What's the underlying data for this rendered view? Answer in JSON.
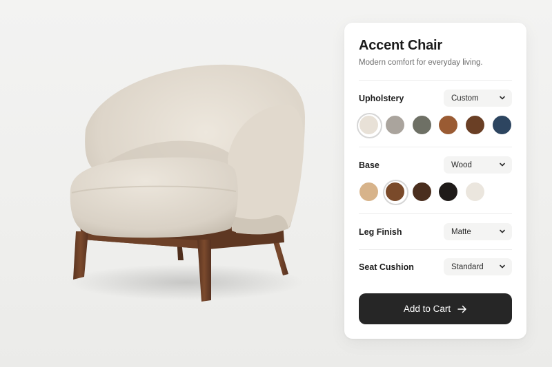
{
  "product": {
    "title": "Accent Chair",
    "subtitle": "Modern comfort for everyday living."
  },
  "upholstery": {
    "label": "Upholstery",
    "selected": "Custom",
    "swatches": [
      {
        "color": "#e8e1d7",
        "selected": true
      },
      {
        "color": "#aaa49d",
        "selected": false
      },
      {
        "color": "#6e7065",
        "selected": false
      },
      {
        "color": "#9a5b33",
        "selected": false
      },
      {
        "color": "#6a3f25",
        "selected": false
      },
      {
        "color": "#2d4560",
        "selected": false
      }
    ]
  },
  "base": {
    "label": "Base",
    "selected": "Wood",
    "swatches": [
      {
        "color": "#d7b38a",
        "selected": false
      },
      {
        "color": "#7a4a2a",
        "selected": true
      },
      {
        "color": "#4a2e1e",
        "selected": false
      },
      {
        "color": "#1f1b19",
        "selected": false
      },
      {
        "color": "#ebe6de",
        "selected": false
      }
    ]
  },
  "leg_finish": {
    "label": "Leg Finish",
    "selected": "Matte"
  },
  "seat_cushion": {
    "label": "Seat Cushion",
    "selected": "Standard"
  },
  "cta": {
    "label": "Add to Cart",
    "icon": "arrow-right-icon"
  },
  "colors": {
    "fabric": "#e6dfd4",
    "wood": "#6b3f24",
    "button": "#262626"
  }
}
